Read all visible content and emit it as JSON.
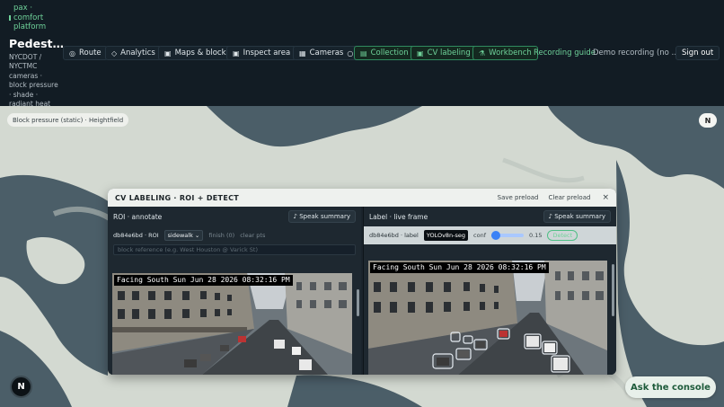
{
  "header": {
    "tagline": "pax · comfort platform",
    "title": "Pedest…",
    "subtitle": "NYCDOT / NYCTMC cameras · block pressure · shade · radiant heat",
    "nav": [
      {
        "label": "Route",
        "icon": "◎",
        "icon_name": "route-icon"
      },
      {
        "label": "Analytics",
        "icon": "◇",
        "icon_name": "analytics-icon"
      },
      {
        "label": "Maps & block",
        "icon": "▣",
        "icon_name": "maps-icon"
      },
      {
        "label": "Inspect area",
        "icon": "▣",
        "icon_name": "inspect-icon"
      },
      {
        "label": "Cameras",
        "icon": "▦",
        "icon_name": "camera-icon",
        "suffix": "○"
      },
      {
        "label": "Collection",
        "icon": "▤",
        "icon_name": "collection-icon"
      },
      {
        "label": "CV labeling",
        "icon": "▣",
        "icon_name": "cv-labeling-icon"
      },
      {
        "label": "Workbench",
        "icon": "⚗",
        "icon_name": "workbench-icon"
      }
    ],
    "recording_guide": "Recording guide",
    "demo_recording": "Demo recording (no …",
    "sign_out": "Sign out"
  },
  "map": {
    "layer_chip": "Block pressure (static) · Heightfield",
    "compass": "N",
    "logo": "N",
    "ask_button": "Ask the console"
  },
  "panel": {
    "title": "CV LABELING · ROI + DETECT",
    "save_preload": "Save preload",
    "clear_preload": "Clear preload",
    "close": "×",
    "roi": {
      "heading": "ROI · annotate",
      "speak": "♪ Speak summary",
      "camera_id": "db84e6bd · ROI",
      "class_select": "sidewalk ⌄",
      "finish": "finish (0)",
      "clear": "clear pts",
      "reference_placeholder": "block reference (e.g. West Houston @ Varick St)",
      "overlay": "Facing South Sun Jun 28 2026 08:32:16 PM"
    },
    "label": {
      "heading": "Label · live frame",
      "speak": "♪ Speak summary",
      "camera_id": "db84e6bd · label",
      "model": "YOLOv8n-seg",
      "conf_label": "conf",
      "conf_value": "0.15",
      "conf_fraction": 0.15,
      "detect": "Detect",
      "overlay": "Facing South Sun Jun 28 2026 08:32:16 PM"
    }
  },
  "colors": {
    "header_bg": "#121c24",
    "accent_green": "#6fd29a",
    "map_land": "#d3d9d1",
    "map_water": "#4b5e68",
    "panel_bg": "#1a232b",
    "slider_blue": "#3b82f6"
  }
}
